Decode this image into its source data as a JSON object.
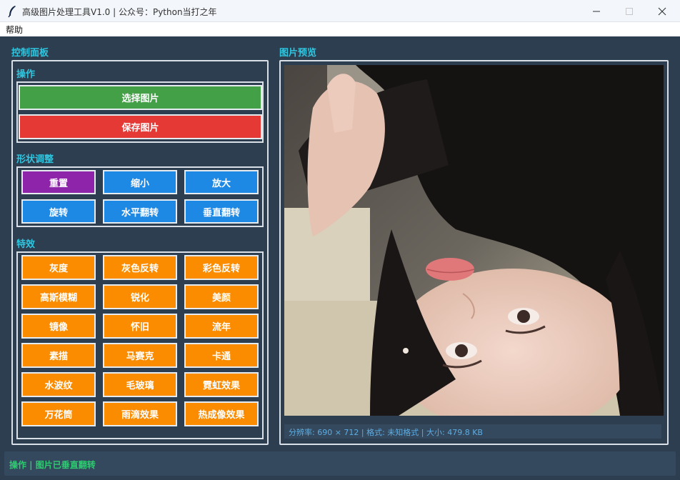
{
  "window": {
    "title": "高级图片处理工具V1.0 | 公众号：Python当打之年",
    "minimize_glyph": "—",
    "maximize_glyph": "☐",
    "close_glyph": "✕"
  },
  "menu": {
    "items": [
      "帮助"
    ]
  },
  "control_panel": {
    "title": "控制面板",
    "operations": {
      "title": "操作",
      "select_image": "选择图片",
      "save_image": "保存图片"
    },
    "shape": {
      "title": "形状调整",
      "buttons": [
        "重置",
        "缩小",
        "放大",
        "旋转",
        "水平翻转",
        "垂直翻转"
      ]
    },
    "effects": {
      "title": "特效",
      "buttons": [
        "灰度",
        "灰色反转",
        "彩色反转",
        "高斯模糊",
        "锐化",
        "美颜",
        "镜像",
        "怀旧",
        "流年",
        "素描",
        "马赛克",
        "卡通",
        "水波纹",
        "毛玻璃",
        "霓虹效果",
        "万花筒",
        "雨滴效果",
        "热成像效果"
      ]
    }
  },
  "preview": {
    "title": "图片预览",
    "info": "分辨率: 690 × 712 | 格式: 未知格式 | 大小: 479.8 KB"
  },
  "status": {
    "text": "操作 | 图片已垂直翻转"
  },
  "colors": {
    "background": "#2c3e50",
    "accent_title": "#30c6e0",
    "green": "#43a047",
    "red": "#e53935",
    "purple": "#8e24aa",
    "blue": "#1e88e5",
    "orange": "#fb8c00",
    "status_text": "#2ecc71"
  }
}
